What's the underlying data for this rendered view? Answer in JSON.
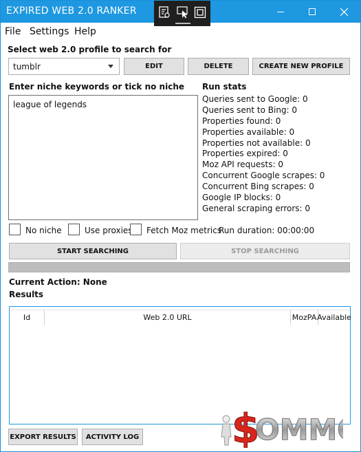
{
  "window": {
    "title": "EXPIRED WEB 2.0 RANKER"
  },
  "menu": {
    "file": "File",
    "settings": "Settings",
    "help": "Help"
  },
  "profile": {
    "heading": "Select web 2.0 profile to search for",
    "selected": "tumblr",
    "edit_label": "EDIT",
    "delete_label": "DELETE",
    "create_label": "CREATE NEW PROFILE"
  },
  "keywords": {
    "heading": "Enter niche keywords or tick no niche",
    "value": "league of legends"
  },
  "run_stats": {
    "heading": "Run stats",
    "items": [
      "Queries sent to Google: 0",
      "Queries sent to Bing: 0",
      "Properties found: 0",
      "Properties available: 0",
      "Properties not available: 0",
      "Properties expired: 0",
      "Moz API requests: 0",
      "Concurrent Google scrapes: 0",
      "Concurrent Bing scrapes: 0",
      "Google IP blocks: 0",
      "General scraping errors: 0"
    ]
  },
  "options": {
    "no_niche": "No niche",
    "use_proxies": "Use proxies",
    "fetch_moz": "Fetch Moz metrics",
    "run_duration": "Run duration: 00:00:00"
  },
  "actions": {
    "start_label": "START SEARCHING",
    "stop_label": "STOP SEARCHING",
    "progress": 0
  },
  "status": {
    "current_action": "Current Action: None",
    "results_heading": "Results"
  },
  "results_table": {
    "columns": [
      "Id",
      "Web 2.0 URL",
      "MozPA",
      "Available"
    ],
    "rows": []
  },
  "footer": {
    "export_label": "EXPORT RESULTS",
    "activity_label": "ACTIVITY LOG"
  },
  "watermark": {
    "text": "$OMMO"
  },
  "colors": {
    "titlebar": "#1e98e0",
    "accent": "#1e98e0",
    "watermark_red": "#d9261c"
  }
}
